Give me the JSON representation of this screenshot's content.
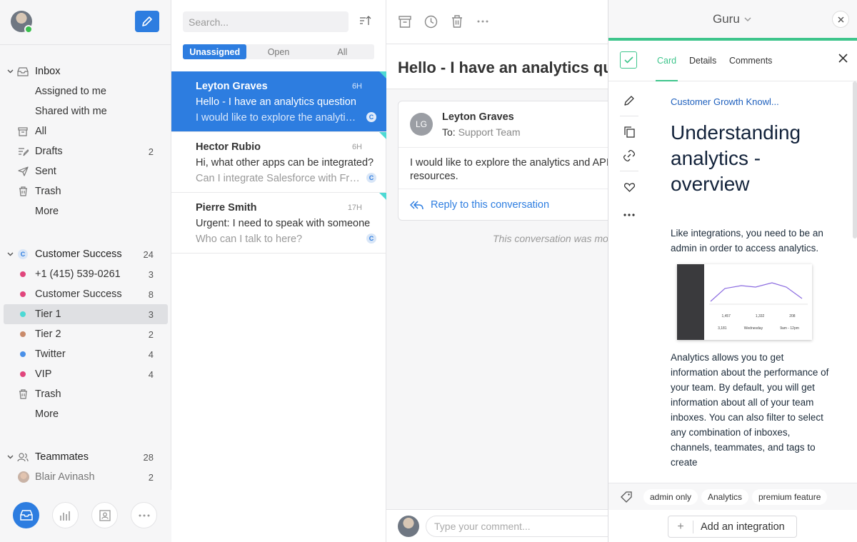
{
  "sidebar": {
    "inbox_section": {
      "header": "Inbox",
      "items": [
        {
          "label": "Assigned to me",
          "count": ""
        },
        {
          "label": "Shared with me",
          "count": ""
        },
        {
          "label": "All",
          "count": ""
        },
        {
          "label": "Drafts",
          "count": "2"
        },
        {
          "label": "Sent",
          "count": ""
        },
        {
          "label": "Trash",
          "count": ""
        },
        {
          "label": "More",
          "count": ""
        }
      ]
    },
    "team_section": {
      "badge": "C",
      "header": "Customer Success",
      "count": "24",
      "items": [
        {
          "label": "+1 (415) 539-0261",
          "count": "3",
          "color": "#e0467c"
        },
        {
          "label": "Customer Success",
          "count": "8",
          "color": "#e0467c"
        },
        {
          "label": "Tier 1",
          "count": "3",
          "color": "#4dd9d4"
        },
        {
          "label": "Tier 2",
          "count": "2",
          "color": "#c98a6a"
        },
        {
          "label": "Twitter",
          "count": "4",
          "color": "#4a90e8"
        },
        {
          "label": "VIP",
          "count": "4",
          "color": "#e0467c"
        },
        {
          "label": "Trash",
          "count": ""
        },
        {
          "label": "More",
          "count": ""
        }
      ]
    },
    "teammates_section": {
      "header": "Teammates",
      "count": "28",
      "items": [
        {
          "label": "Blair Avinash",
          "count": "2"
        }
      ]
    }
  },
  "list": {
    "search_placeholder": "Search...",
    "filters": [
      "Unassigned",
      "Open",
      "All"
    ],
    "conversations": [
      {
        "name": "Leyton Graves",
        "time": "6H",
        "subject": "Hello - I have an analytics question",
        "preview": "I would like to explore the analytics and API resources.",
        "badge": "C"
      },
      {
        "name": "Hector Rubio",
        "time": "6H",
        "subject": "Hi, what other apps can be integrated?",
        "preview": "Can I integrate Salesforce with Front?",
        "badge": "C"
      },
      {
        "name": "Pierre Smith",
        "time": "17H",
        "subject": "Urgent: I need to speak with someone",
        "preview": "Who can I talk to here?",
        "badge": "C"
      }
    ]
  },
  "conversation": {
    "title": "Hello - I have an analytics question",
    "message": {
      "initials": "LG",
      "from": "Leyton Graves",
      "to_label": "To:",
      "to": "Support Team",
      "body": "I would like to explore the analytics and API resources.",
      "reply": "Reply to this conversation"
    },
    "system_note": "This conversation was moved",
    "comment_placeholder": "Type your comment..."
  },
  "guru": {
    "title": "Guru",
    "tabs": [
      "Card",
      "Details",
      "Comments"
    ],
    "breadcrumb": "Customer Growth Knowl...",
    "card_title": "Understanding analytics - overview",
    "para1": "Like integrations, you need to be an admin in order to access analytics.",
    "para2": "Analytics allows you to get information about the performance of your team. By default, you will get information about all of your team inboxes. You can also filter to select any combination of inboxes, channels, teammates, and tags to create",
    "screenshot_stats": [
      "1,457",
      "1,332",
      "208",
      "3,181",
      "Wednesday",
      "9am - 12pm"
    ],
    "tags": [
      "admin only",
      "Analytics",
      "premium feature"
    ],
    "add_integration": "Add an integration"
  },
  "colors": {
    "accent": "#2d7de0",
    "guru_green": "#3fc58c",
    "corner_teal": "#4dd9d4"
  }
}
